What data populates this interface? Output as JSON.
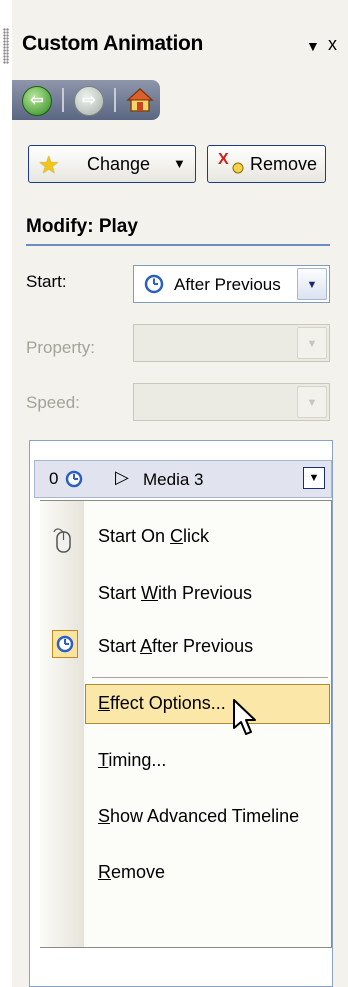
{
  "pane": {
    "title": "Custom Animation",
    "dropdown_glyph": "▼",
    "close_glyph": "x",
    "nav": {
      "back_icon": "back-arrow-icon",
      "forward_icon": "forward-arrow-icon",
      "home_icon": "home-icon"
    }
  },
  "toolbar": {
    "change_label": "Change",
    "remove_label": "Remove"
  },
  "modify": {
    "title": "Modify: Play",
    "start_label": "Start:",
    "start_value": "After Previous",
    "property_label": "Property:",
    "speed_label": "Speed:"
  },
  "effect_list": {
    "item": {
      "order": "0",
      "name": "Media 3"
    }
  },
  "context_menu": {
    "start_on_click": {
      "pre": "Start On ",
      "key": "C",
      "post": "lick"
    },
    "start_with_previous": {
      "pre": "Start ",
      "key": "W",
      "post": "ith Previous"
    },
    "start_after_previous": {
      "pre": "Start ",
      "key": "A",
      "post": "fter Previous"
    },
    "effect_options": {
      "pre": "",
      "key": "E",
      "post": "ffect Options..."
    },
    "timing": {
      "pre": "",
      "key": "T",
      "post": "iming..."
    },
    "show_advanced_timeline": {
      "pre": "",
      "key": "S",
      "post": "how Advanced Timeline"
    },
    "remove": {
      "pre": "",
      "key": "R",
      "post": "emove"
    },
    "highlighted_item": "effect_options",
    "checked_item": "start_after_previous"
  },
  "colors": {
    "pane_bg": "#f3f2ec",
    "accent_line": "#6f8bc4",
    "menu_highlight": "#fbe8a9",
    "nav_bar": "#5b6683"
  }
}
